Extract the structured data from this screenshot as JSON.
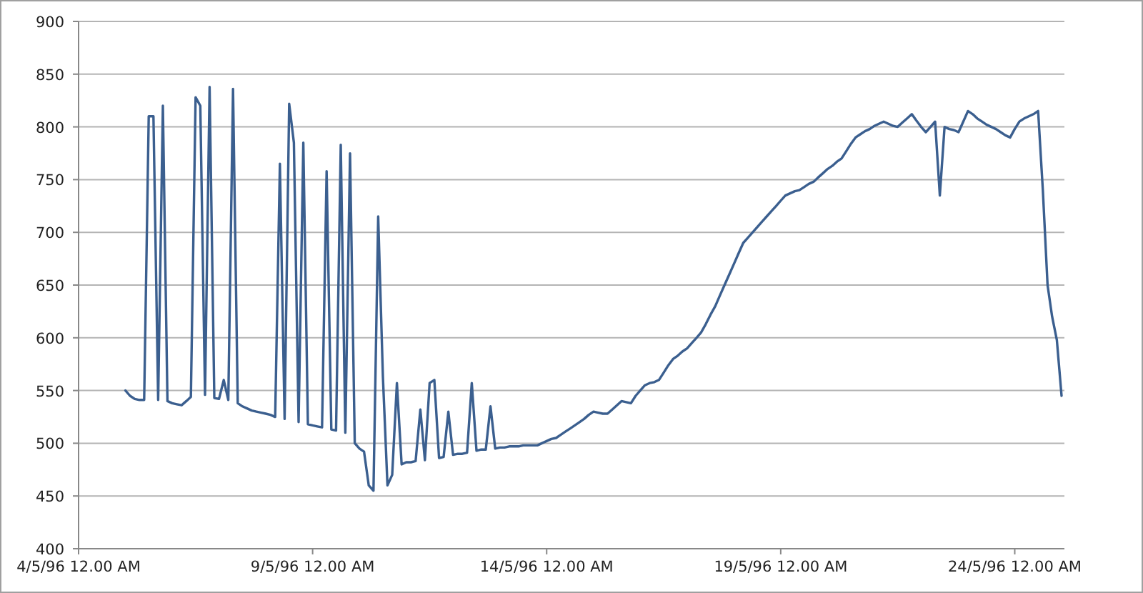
{
  "chart": {
    "chart_data": {
      "type": "line",
      "grid": true,
      "ylim": [
        400,
        900
      ],
      "yticks": [
        400,
        450,
        500,
        550,
        600,
        650,
        700,
        750,
        800,
        850,
        900
      ],
      "categories": [
        "4/5/96 12.00 AM",
        null,
        null,
        null,
        null,
        null,
        null,
        null,
        null,
        null,
        null,
        null,
        null,
        null,
        null,
        null,
        null,
        null,
        null,
        null,
        null,
        null,
        null,
        null,
        null,
        null,
        null,
        null,
        null,
        null,
        null,
        null,
        null,
        null,
        null,
        null,
        null,
        null,
        null,
        null,
        null,
        null,
        null,
        null,
        null,
        null,
        null,
        null,
        null,
        null,
        "9/5/96 12.00 AM",
        null,
        null,
        null,
        null,
        null,
        null,
        null,
        null,
        null,
        null,
        null,
        null,
        null,
        null,
        null,
        null,
        null,
        null,
        null,
        null,
        null,
        null,
        null,
        null,
        null,
        null,
        null,
        null,
        null,
        null,
        null,
        null,
        null,
        null,
        null,
        null,
        null,
        null,
        null,
        null,
        null,
        null,
        null,
        null,
        null,
        null,
        null,
        null,
        null,
        "14/5/96 12.00 AM",
        null,
        null,
        null,
        null,
        null,
        null,
        null,
        null,
        null,
        null,
        null,
        null,
        null,
        null,
        null,
        null,
        null,
        null,
        null,
        null,
        null,
        null,
        null,
        null,
        null,
        null,
        null,
        null,
        null,
        null,
        null,
        null,
        null,
        null,
        null,
        null,
        null,
        null,
        null,
        null,
        null,
        null,
        null,
        null,
        null,
        null,
        null,
        null,
        null,
        "19/5/96 12.00 AM",
        null,
        null,
        null,
        null,
        null,
        null,
        null,
        null,
        null,
        null,
        null,
        null,
        null,
        null,
        null,
        null,
        null,
        null,
        null,
        null,
        null,
        null,
        null,
        null,
        null,
        null,
        null,
        null,
        null,
        null,
        null,
        null,
        null,
        null,
        null,
        null,
        null,
        null,
        null,
        null,
        null,
        null,
        null,
        null,
        null,
        null,
        null,
        null,
        null,
        "24/5/96 12.00 AM",
        null,
        null,
        null,
        null,
        null,
        null,
        null,
        null,
        null,
        null
      ],
      "series": [
        {
          "color": "#3b5f8f",
          "values": [
            null,
            null,
            null,
            null,
            null,
            null,
            null,
            null,
            null,
            null,
            550,
            545,
            542,
            541,
            541,
            810,
            810,
            541,
            820,
            540,
            538,
            537,
            536,
            540,
            544,
            828,
            820,
            546,
            838,
            543,
            542,
            560,
            541,
            836,
            538,
            535,
            533,
            531,
            530,
            529,
            528,
            527,
            525,
            765,
            523,
            822,
            785,
            520,
            785,
            518,
            517,
            516,
            515,
            758,
            513,
            512,
            783,
            510,
            775,
            500,
            495,
            492,
            460,
            455,
            715,
            563,
            460,
            470,
            557,
            480,
            482,
            482,
            483,
            532,
            484,
            557,
            560,
            486,
            487,
            530,
            489,
            490,
            490,
            491,
            557,
            493,
            494,
            494,
            535,
            495,
            496,
            496,
            497,
            497,
            497,
            498,
            498,
            498,
            498,
            500,
            502,
            504,
            505,
            508,
            511,
            514,
            517,
            520,
            523,
            527,
            530,
            529,
            528,
            528,
            532,
            536,
            540,
            539,
            538,
            545,
            550,
            555,
            557,
            558,
            560,
            567,
            574,
            580,
            583,
            587,
            590,
            595,
            600,
            605,
            613,
            622,
            630,
            640,
            650,
            660,
            670,
            680,
            690,
            695,
            700,
            705,
            710,
            715,
            720,
            725,
            730,
            735,
            737,
            739,
            740,
            743,
            746,
            748,
            752,
            756,
            760,
            763,
            767,
            770,
            777,
            784,
            790,
            793,
            796,
            798,
            801,
            803,
            805,
            803,
            801,
            800,
            804,
            808,
            812,
            806,
            800,
            795,
            800,
            805,
            735,
            800,
            798,
            797,
            795,
            805,
            815,
            812,
            808,
            805,
            802,
            800,
            798,
            795,
            792,
            790,
            798,
            805,
            808,
            810,
            812,
            815,
            740,
            650,
            620,
            598,
            545
          ]
        }
      ]
    }
  }
}
